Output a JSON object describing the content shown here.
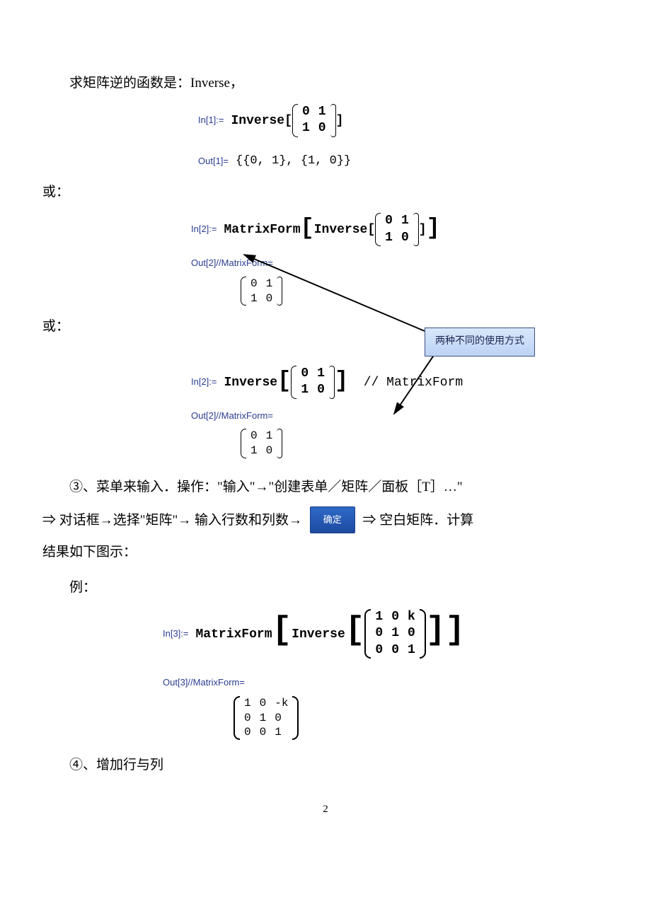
{
  "intro": "求矩阵逆的函数是：Inverse，",
  "block1": {
    "in_label": "In[1]:=",
    "fn": "Inverse",
    "rows": [
      [
        "0",
        "1"
      ],
      [
        "1",
        "0"
      ]
    ],
    "out_label": "Out[1]=",
    "out_text": "{{0, 1}, {1, 0}}"
  },
  "or_text": "或：",
  "block2": {
    "in_label": "In[2]:=",
    "fn_outer": "MatrixForm",
    "fn_inner": "Inverse",
    "rows": [
      [
        "0",
        "1"
      ],
      [
        "1",
        "0"
      ]
    ],
    "out_label": "Out[2]//MatrixForm=",
    "out_rows": [
      [
        "0",
        "1"
      ],
      [
        "1",
        "0"
      ]
    ]
  },
  "callout_text": "两种不同的使用方式",
  "block3": {
    "in_label": "In[2]:=",
    "fn": "Inverse",
    "rows": [
      [
        "0",
        "1"
      ],
      [
        "1",
        "0"
      ]
    ],
    "comment": "// MatrixForm",
    "out_label": "Out[2]//MatrixForm=",
    "out_rows": [
      [
        "0",
        "1"
      ],
      [
        "1",
        "0"
      ]
    ]
  },
  "menu_para": {
    "prefix": "③、菜单来输入．操作：\"输入\"→\"创建表单／矩阵／面板［T］…\"",
    "line2_a": "⇒ 对话框→选择\"矩阵\"→ 输入行数和列数→ ",
    "btn": "确定",
    "line2_b": " ⇒ 空白矩阵．计算",
    "line3": "结果如下图示："
  },
  "example_label": "例：",
  "block4": {
    "in_label": "In[3]:=",
    "fn_outer": "MatrixForm",
    "fn_inner": "Inverse",
    "rows": [
      [
        "1",
        "0",
        "k"
      ],
      [
        "0",
        "1",
        "0"
      ],
      [
        "0",
        "0",
        "1"
      ]
    ],
    "out_label": "Out[3]//MatrixForm=",
    "out_rows": [
      [
        "1",
        "0",
        "-k"
      ],
      [
        "0",
        "1",
        "0"
      ],
      [
        "0",
        "0",
        "1"
      ]
    ]
  },
  "tail": "④、增加行与列",
  "page_number": "2"
}
